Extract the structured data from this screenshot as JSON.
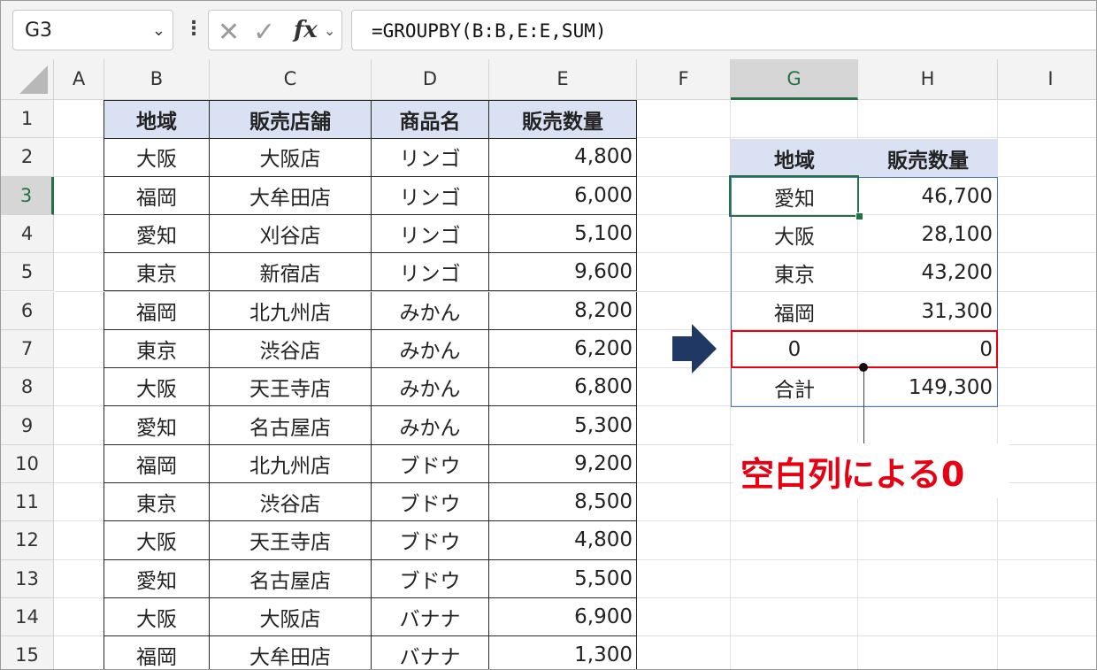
{
  "formula_bar": {
    "name_box": "G3",
    "formula": "=GROUPBY(B:B,E:E,SUM)"
  },
  "columns": [
    "A",
    "B",
    "C",
    "D",
    "E",
    "F",
    "G",
    "H",
    "I"
  ],
  "selected_column": "G",
  "selected_row": "3",
  "rows": [
    "1",
    "2",
    "3",
    "4",
    "5",
    "6",
    "7",
    "8",
    "9",
    "10",
    "11",
    "12",
    "13",
    "14",
    "15"
  ],
  "source_table": {
    "headers": [
      "地域",
      "販売店舗",
      "商品名",
      "販売数量"
    ],
    "data": [
      [
        "大阪",
        "大阪店",
        "リンゴ",
        "4,800"
      ],
      [
        "福岡",
        "大牟田店",
        "リンゴ",
        "6,000"
      ],
      [
        "愛知",
        "刈谷店",
        "リンゴ",
        "5,100"
      ],
      [
        "東京",
        "新宿店",
        "リンゴ",
        "9,600"
      ],
      [
        "福岡",
        "北九州店",
        "みかん",
        "8,200"
      ],
      [
        "東京",
        "渋谷店",
        "みかん",
        "6,200"
      ],
      [
        "大阪",
        "天王寺店",
        "みかん",
        "6,800"
      ],
      [
        "愛知",
        "名古屋店",
        "みかん",
        "5,300"
      ],
      [
        "福岡",
        "北九州店",
        "ブドウ",
        "9,200"
      ],
      [
        "東京",
        "渋谷店",
        "ブドウ",
        "8,500"
      ],
      [
        "大阪",
        "天王寺店",
        "ブドウ",
        "4,800"
      ],
      [
        "愛知",
        "名古屋店",
        "ブドウ",
        "5,500"
      ],
      [
        "大阪",
        "大阪店",
        "バナナ",
        "6,900"
      ],
      [
        "福岡",
        "大牟田店",
        "バナナ",
        "1,300"
      ]
    ]
  },
  "result_table": {
    "headers": [
      "地域",
      "販売数量"
    ],
    "data": [
      [
        "愛知",
        "46,700"
      ],
      [
        "大阪",
        "28,100"
      ],
      [
        "東京",
        "43,200"
      ],
      [
        "福岡",
        "31,300"
      ],
      [
        "0",
        "0"
      ],
      [
        "合計",
        "149,300"
      ]
    ]
  },
  "annotation": "空白列による0",
  "colors": {
    "accent_green": "#217346",
    "header_fill": "#d9e1f2",
    "highlight_red": "#e60012",
    "arrow_navy": "#1f3864"
  }
}
